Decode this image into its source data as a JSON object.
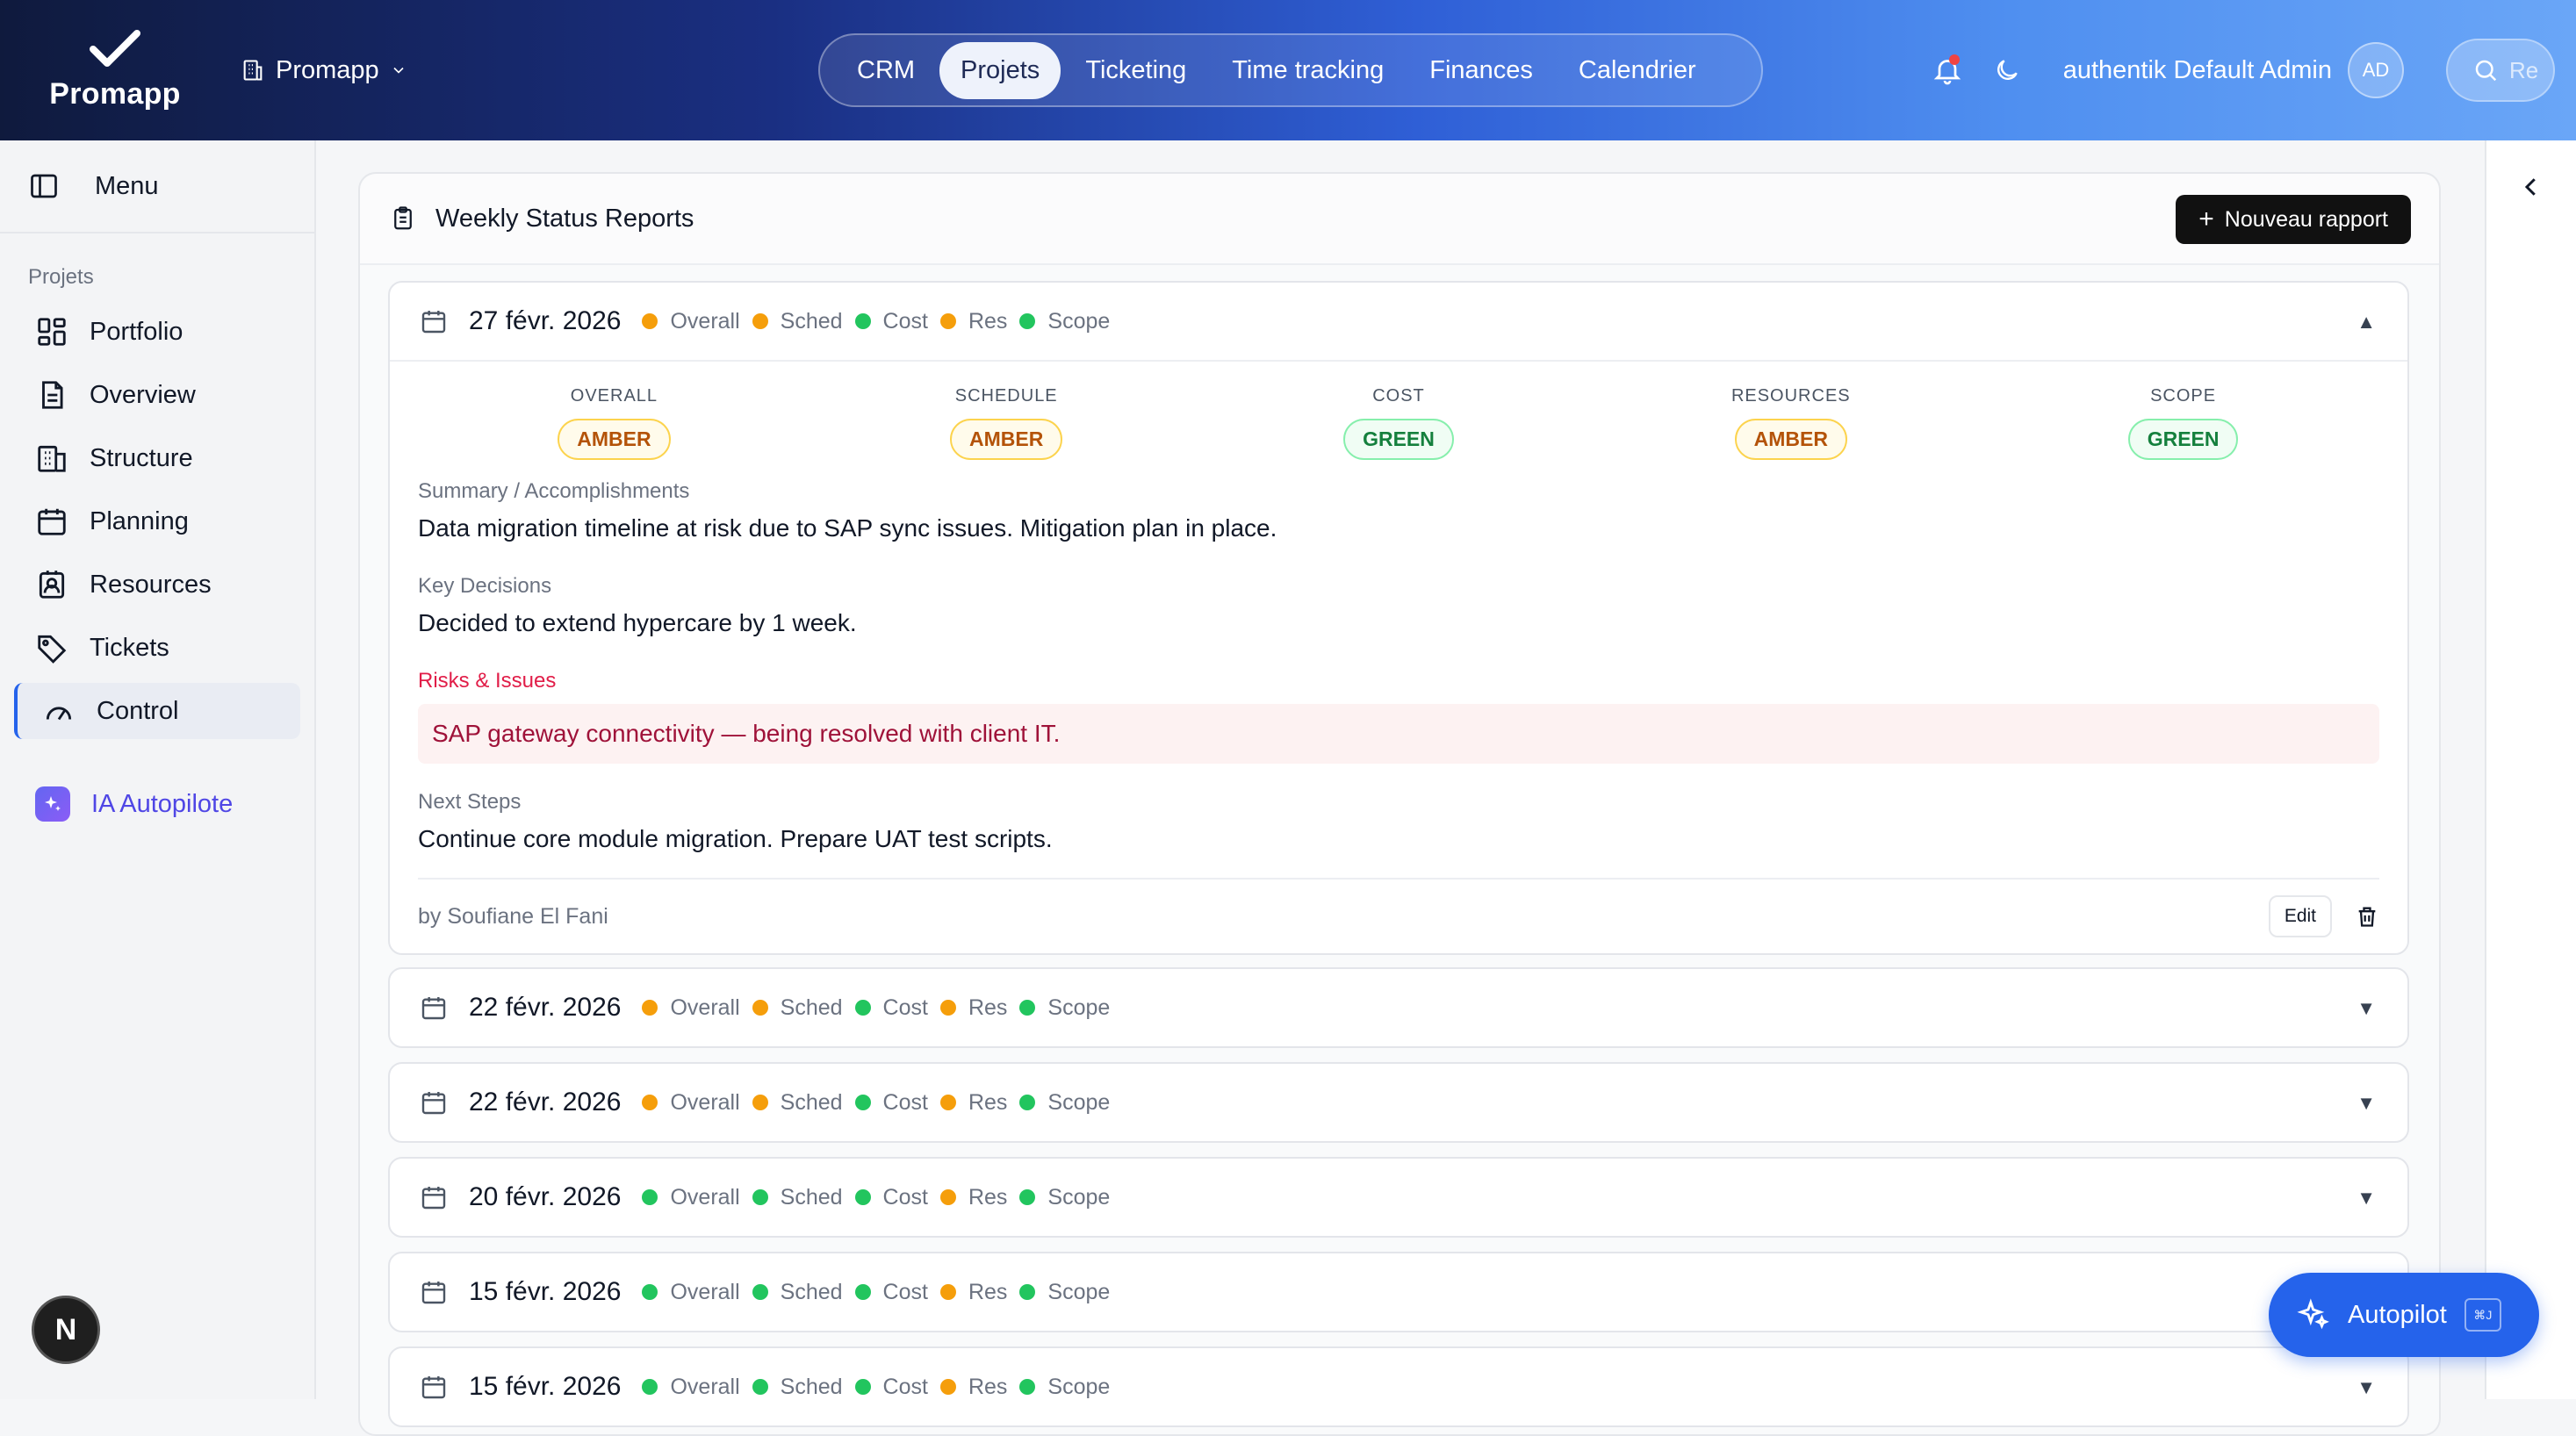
{
  "app": {
    "name": "Promapp",
    "workspace": "Promapp"
  },
  "topnav": {
    "items": [
      {
        "label": "CRM"
      },
      {
        "label": "Projets"
      },
      {
        "label": "Ticketing"
      },
      {
        "label": "Time tracking"
      },
      {
        "label": "Finances"
      },
      {
        "label": "Calendrier"
      }
    ],
    "active": "Projets"
  },
  "user": {
    "name": "authentik Default Admin",
    "initials": "AD"
  },
  "search": {
    "placeholder": "Re"
  },
  "sidebar": {
    "menu_label": "Menu",
    "section_label": "Projets",
    "items": [
      {
        "label": "Portfolio",
        "icon": "grid-icon"
      },
      {
        "label": "Overview",
        "icon": "document-icon"
      },
      {
        "label": "Structure",
        "icon": "building-icon"
      },
      {
        "label": "Planning",
        "icon": "calendar-icon"
      },
      {
        "label": "Resources",
        "icon": "contact-icon"
      },
      {
        "label": "Tickets",
        "icon": "tag-icon"
      },
      {
        "label": "Control",
        "icon": "gauge-icon"
      }
    ],
    "active": "Control",
    "ai_label": "IA Autopilote"
  },
  "page": {
    "title": "Weekly Status Reports",
    "new_button": "Nouveau rapport"
  },
  "status_labels": [
    "Overall",
    "Sched",
    "Cost",
    "Res",
    "Scope"
  ],
  "colors": {
    "amber": "#f59e0b",
    "green": "#22c55e",
    "accent": "#2563eb",
    "risk": "#e11d48"
  },
  "reports": [
    {
      "date": "27 févr. 2026",
      "statuses": [
        "amber",
        "amber",
        "green",
        "amber",
        "green"
      ],
      "expanded": true
    },
    {
      "date": "22 févr. 2026",
      "statuses": [
        "amber",
        "amber",
        "green",
        "amber",
        "green"
      ],
      "expanded": false
    },
    {
      "date": "22 févr. 2026",
      "statuses": [
        "amber",
        "amber",
        "green",
        "amber",
        "green"
      ],
      "expanded": false
    },
    {
      "date": "20 févr. 2026",
      "statuses": [
        "green",
        "green",
        "green",
        "amber",
        "green"
      ],
      "expanded": false
    },
    {
      "date": "15 févr. 2026",
      "statuses": [
        "green",
        "green",
        "green",
        "amber",
        "green"
      ],
      "expanded": false
    },
    {
      "date": "15 févr. 2026",
      "statuses": [
        "green",
        "green",
        "green",
        "amber",
        "green"
      ],
      "expanded": false
    }
  ],
  "detail": {
    "rag": [
      {
        "label": "OVERALL",
        "value": "AMBER"
      },
      {
        "label": "SCHEDULE",
        "value": "AMBER"
      },
      {
        "label": "COST",
        "value": "GREEN"
      },
      {
        "label": "RESOURCES",
        "value": "AMBER"
      },
      {
        "label": "SCOPE",
        "value": "GREEN"
      }
    ],
    "summary_label": "Summary / Accomplishments",
    "summary": "Data migration timeline at risk due to SAP sync issues. Mitigation plan in place.",
    "decisions_label": "Key Decisions",
    "decisions": "Decided to extend hypercare by 1 week.",
    "risks_label": "Risks & Issues",
    "risks": "SAP gateway connectivity — being resolved with client IT.",
    "next_label": "Next Steps",
    "next": "Continue core module migration. Prepare UAT test scripts.",
    "author": "by Soufiane El Fani",
    "edit_label": "Edit"
  },
  "fab": {
    "label": "Autopilot",
    "shortcut": "⌘J"
  },
  "badge": "N"
}
